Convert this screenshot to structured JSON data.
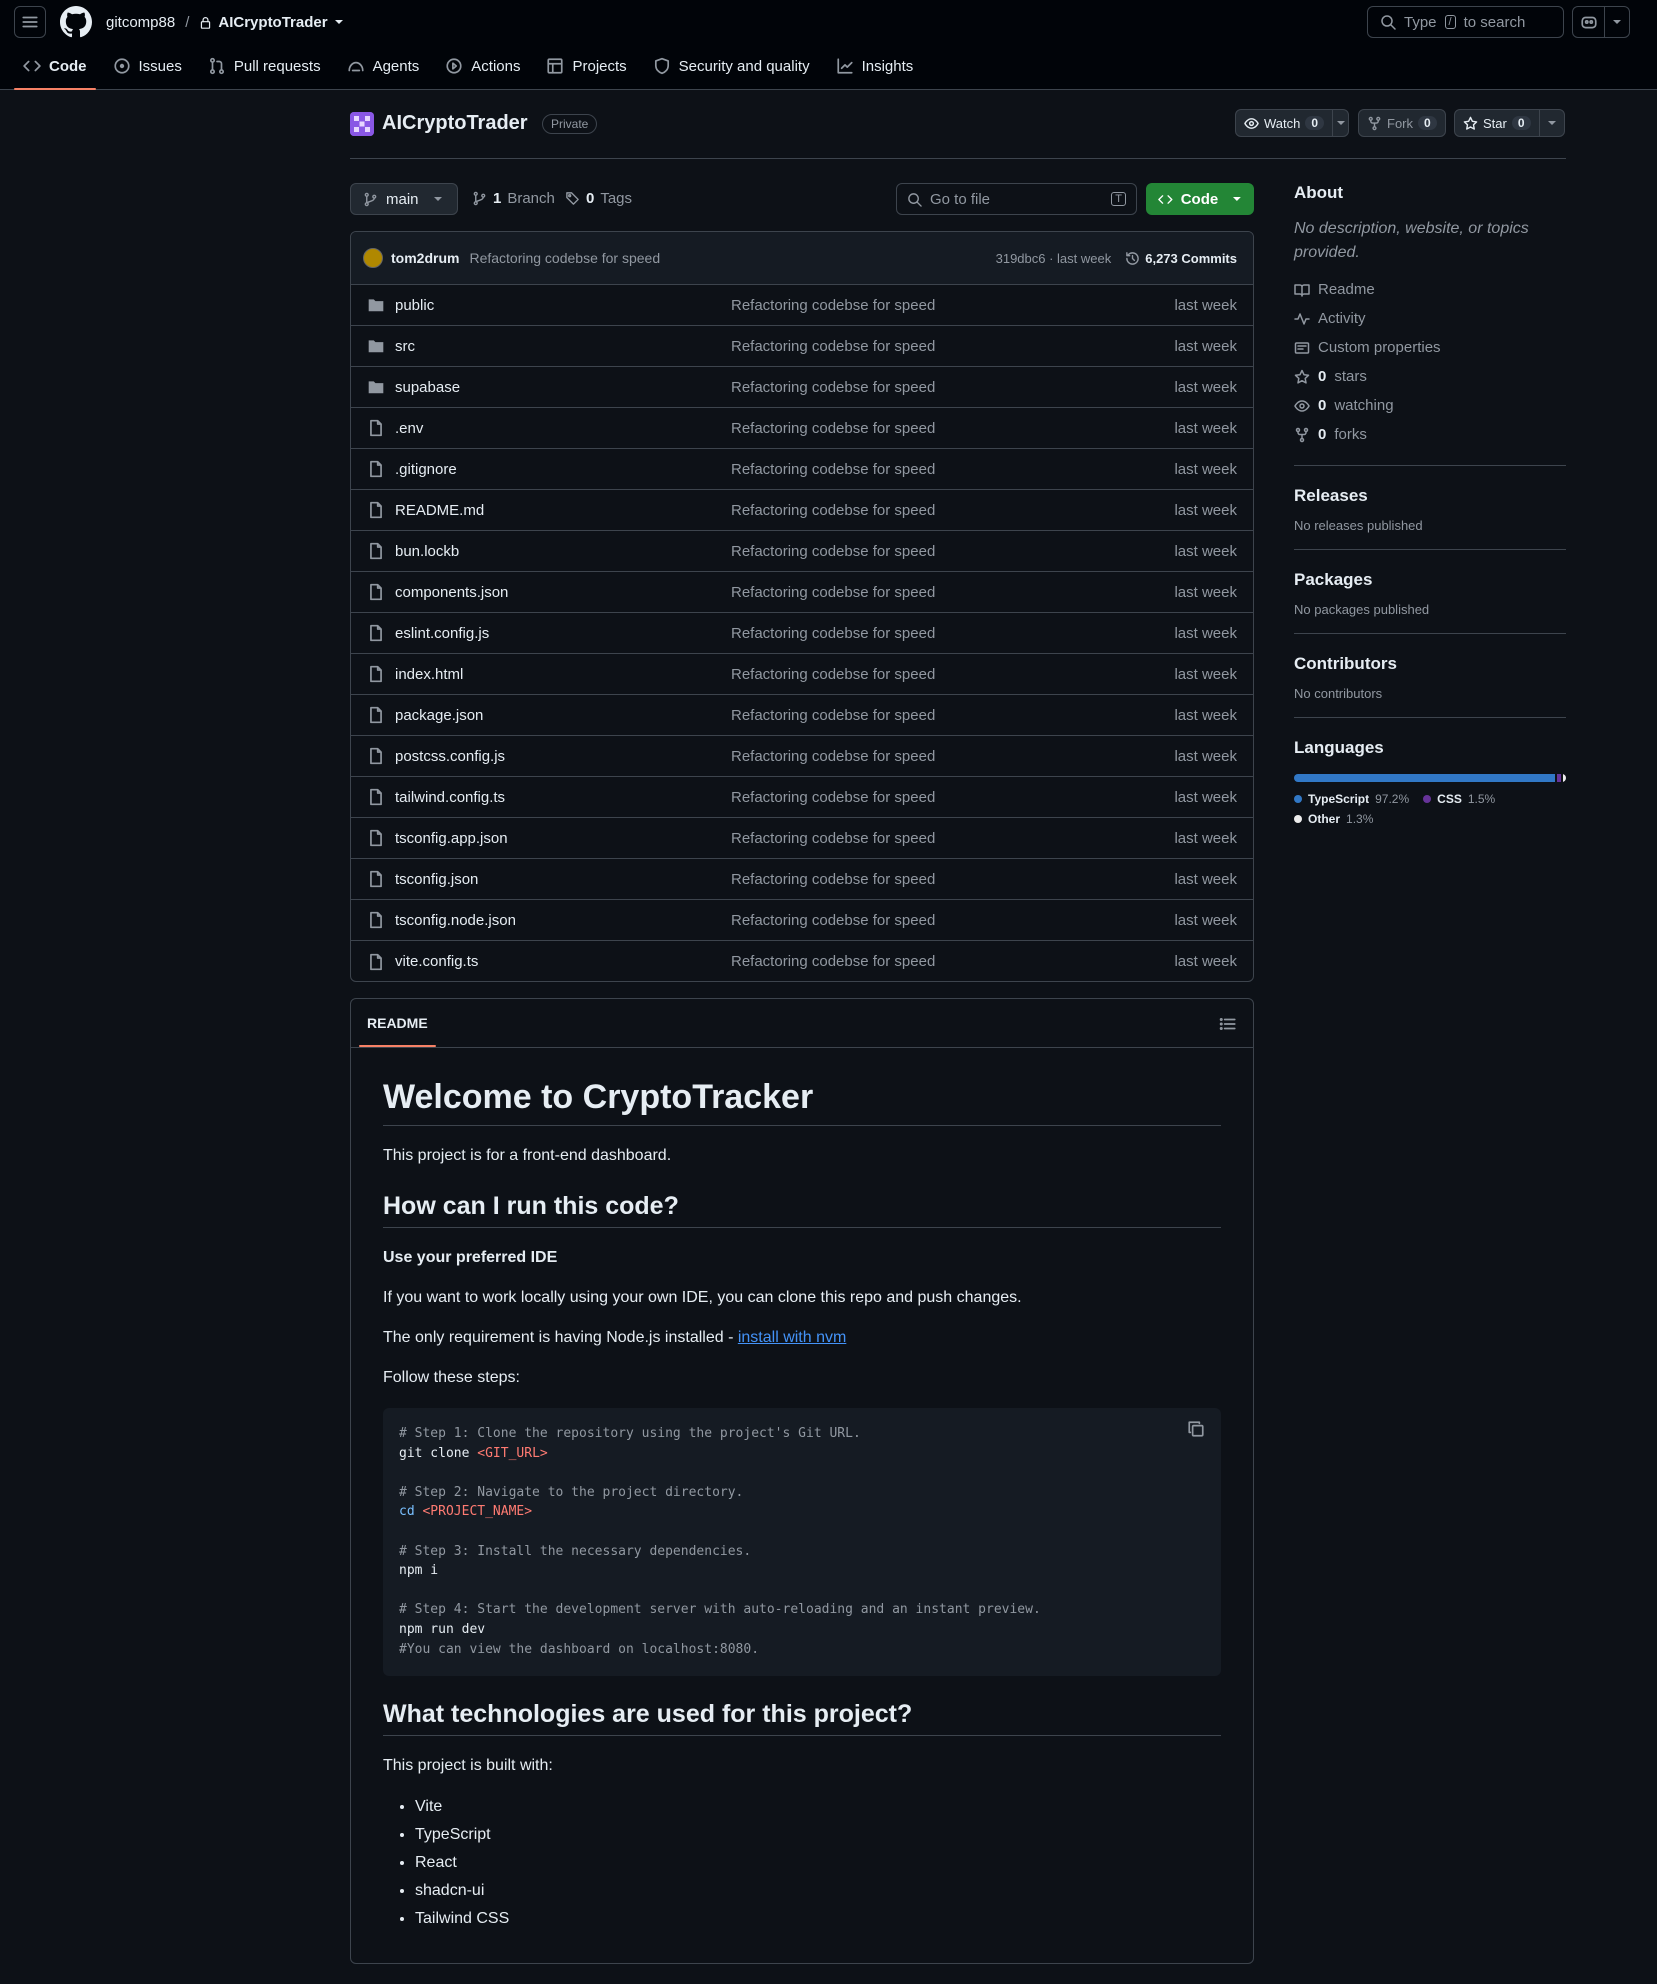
{
  "header": {
    "owner": "gitcomp88",
    "separator": "/",
    "repo": "AICryptoTrader",
    "search_prefix": "Type",
    "search_key": "/",
    "search_suffix": "to search"
  },
  "tabs": [
    {
      "label": "Code",
      "icon": "code-icon"
    },
    {
      "label": "Issues",
      "icon": "issue-icon"
    },
    {
      "label": "Pull requests",
      "icon": "pull-request-icon"
    },
    {
      "label": "Agents",
      "icon": "agents-icon"
    },
    {
      "label": "Actions",
      "icon": "play-icon"
    },
    {
      "label": "Projects",
      "icon": "table-icon"
    },
    {
      "label": "Security and quality",
      "icon": "shield-icon"
    },
    {
      "label": "Insights",
      "icon": "graph-icon"
    }
  ],
  "repo_header": {
    "name": "AICryptoTrader",
    "visibility": "Private",
    "watch_label": "Watch",
    "watch_count": "0",
    "fork_label": "Fork",
    "fork_count": "0",
    "star_label": "Star",
    "star_count": "0"
  },
  "branch_bar": {
    "branch": "main",
    "branch_count": "1",
    "branch_label": "Branch",
    "tag_count": "0",
    "tag_label": "Tags",
    "goto_placeholder": "Go to file",
    "goto_key": "T",
    "code_label": "Code"
  },
  "commit": {
    "author": "tom2drum",
    "message": "Refactoring codebse for speed",
    "sha_time": "319dbc6 · last week",
    "commits": "6,273 Commits"
  },
  "files": [
    {
      "name": "public",
      "type": "folder",
      "msg": "Refactoring codebse for speed",
      "time": "last week"
    },
    {
      "name": "src",
      "type": "folder",
      "msg": "Refactoring codebse for speed",
      "time": "last week"
    },
    {
      "name": "supabase",
      "type": "folder",
      "msg": "Refactoring codebse for speed",
      "time": "last week"
    },
    {
      "name": ".env",
      "type": "file",
      "msg": "Refactoring codebse for speed",
      "time": "last week"
    },
    {
      "name": ".gitignore",
      "type": "file",
      "msg": "Refactoring codebse for speed",
      "time": "last week"
    },
    {
      "name": "README.md",
      "type": "file",
      "msg": "Refactoring codebse for speed",
      "time": "last week"
    },
    {
      "name": "bun.lockb",
      "type": "file",
      "msg": "Refactoring codebse for speed",
      "time": "last week"
    },
    {
      "name": "components.json",
      "type": "file",
      "msg": "Refactoring codebse for speed",
      "time": "last week"
    },
    {
      "name": "eslint.config.js",
      "type": "file",
      "msg": "Refactoring codebse for speed",
      "time": "last week"
    },
    {
      "name": "index.html",
      "type": "file",
      "msg": "Refactoring codebse for speed",
      "time": "last week"
    },
    {
      "name": "package.json",
      "type": "file",
      "msg": "Refactoring codebse for speed",
      "time": "last week"
    },
    {
      "name": "postcss.config.js",
      "type": "file",
      "msg": "Refactoring codebse for speed",
      "time": "last week"
    },
    {
      "name": "tailwind.config.ts",
      "type": "file",
      "msg": "Refactoring codebse for speed",
      "time": "last week"
    },
    {
      "name": "tsconfig.app.json",
      "type": "file",
      "msg": "Refactoring codebse for speed",
      "time": "last week"
    },
    {
      "name": "tsconfig.json",
      "type": "file",
      "msg": "Refactoring codebse for speed",
      "time": "last week"
    },
    {
      "name": "tsconfig.node.json",
      "type": "file",
      "msg": "Refactoring codebse for speed",
      "time": "last week"
    },
    {
      "name": "vite.config.ts",
      "type": "file",
      "msg": "Refactoring codebse for speed",
      "time": "last week"
    }
  ],
  "readme": {
    "tab": "README",
    "h1": "Welcome to CryptoTracker",
    "intro": "This project is for a front-end dashboard.",
    "h2_run": "How can I run this code?",
    "ide_heading": "Use your preferred IDE",
    "ide_text": "If you want to work locally using your own IDE, you can clone this repo and push changes.",
    "req_text": "The only requirement is having Node.js installed - ",
    "req_link": "install with nvm",
    "steps_text": "Follow these steps:",
    "code": {
      "c1": "# Step 1: Clone the repository using the project's Git URL.",
      "l1a": "git clone ",
      "l1b": "<GIT_URL>",
      "c2": "# Step 2: Navigate to the project directory.",
      "l2a": "cd",
      "l2b": " <PROJECT_NAME>",
      "c3": "# Step 3: Install the necessary dependencies.",
      "l3": "npm i",
      "c4": "# Step 4: Start the development server with auto-reloading and an instant preview.",
      "l4": "npm run dev",
      "c5": "#You can view the dashboard on localhost:8080."
    },
    "h2_tech": "What technologies are used for this project?",
    "built_text": "This project is built with:",
    "tech": [
      "Vite",
      "TypeScript",
      "React",
      "shadcn-ui",
      "Tailwind CSS"
    ]
  },
  "about": {
    "title": "About",
    "desc": "No description, website, or topics provided.",
    "links": [
      {
        "label": "Readme",
        "icon": "book-icon"
      },
      {
        "label": "Activity",
        "icon": "pulse-icon"
      },
      {
        "label": "Custom properties",
        "icon": "note-icon"
      }
    ],
    "stats": [
      {
        "count": "0",
        "label": "stars",
        "icon": "star-icon"
      },
      {
        "count": "0",
        "label": "watching",
        "icon": "eye-icon"
      },
      {
        "count": "0",
        "label": "forks",
        "icon": "fork-icon"
      }
    ]
  },
  "releases": {
    "title": "Releases",
    "text": "No releases published"
  },
  "packages": {
    "title": "Packages",
    "text": "No packages published"
  },
  "contributors": {
    "title": "Contributors",
    "text": "No contributors"
  },
  "languages": {
    "title": "Languages",
    "items": [
      {
        "name": "TypeScript",
        "pct": "97.2%",
        "value": 97.2,
        "color": "#3178c6"
      },
      {
        "name": "CSS",
        "pct": "1.5%",
        "value": 1.5,
        "color": "#663399"
      },
      {
        "name": "Other",
        "pct": "1.3%",
        "value": 1.3,
        "color": "#ededed"
      }
    ]
  }
}
